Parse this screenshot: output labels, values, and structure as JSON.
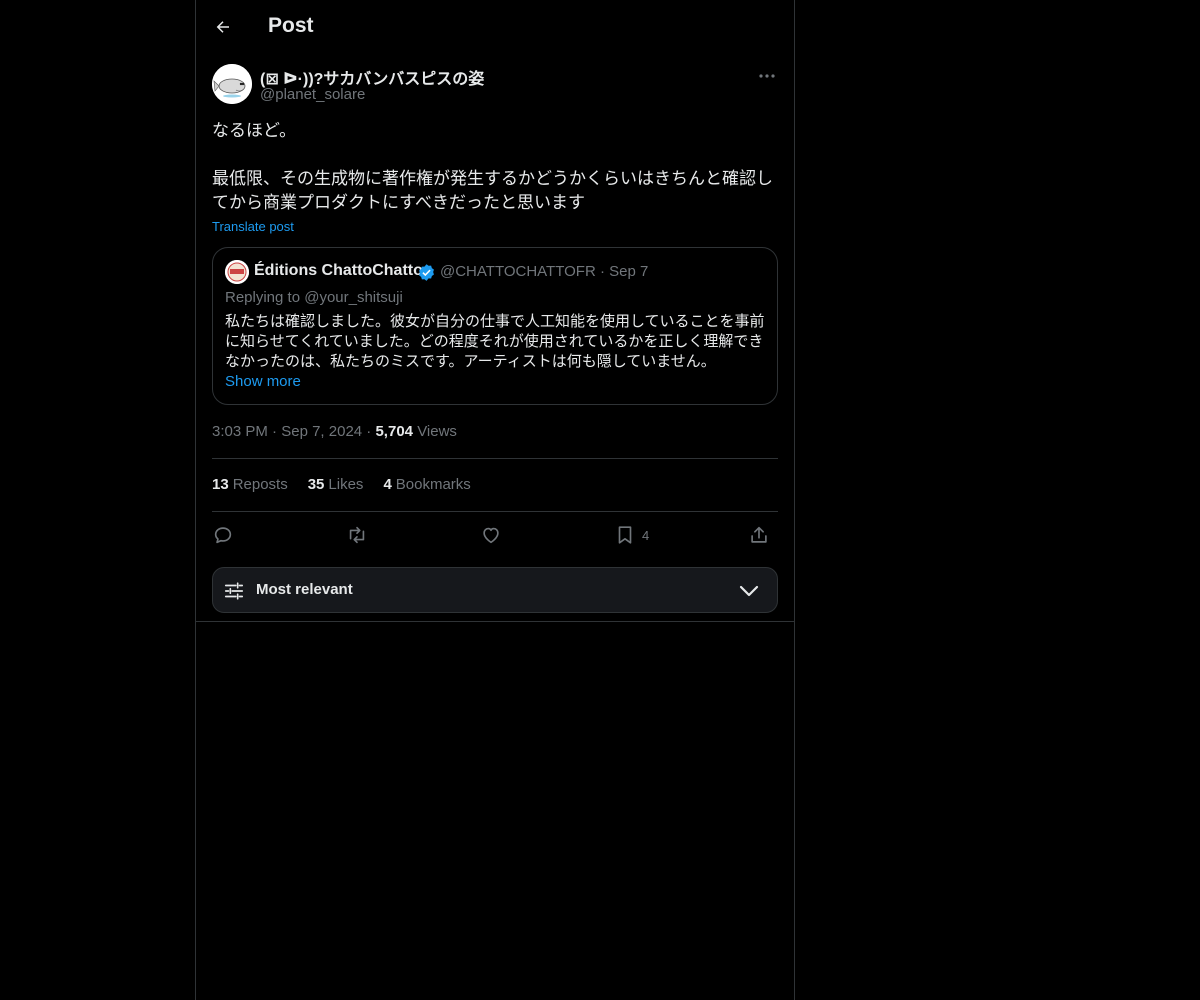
{
  "header": {
    "title": "Post"
  },
  "post": {
    "author_name": "(⊠ ᐅ·))?サカバンバスピスの姿",
    "author_handle": "@planet_solare",
    "text": "なるほど。\n\n最低限、その生成物に著作権が発生するかどうかくらいはきちんと確認してから商業プロダクトにすべきだったと思います",
    "translate_label": "Translate post",
    "time": "3:03 PM",
    "date": "Sep 7, 2024",
    "views_count": "5,704",
    "views_label": "Views"
  },
  "quote": {
    "author_name": "Éditions ChattoChatto",
    "author_handle": "@CHATTOCHATTOFR",
    "date": "Sep 7",
    "replying_to": "Replying to @your_shitsuji",
    "text": "私たちは確認しました。彼女が自分の仕事で人工知能を使用していることを事前に知らせてくれていました。どの程度それが使用されているかを正しく理解できなかったのは、私たちのミスです。アーティストは何も隠していません。",
    "show_more": "Show more"
  },
  "stats": {
    "reposts_count": "13",
    "reposts_label": "Reposts",
    "likes_count": "35",
    "likes_label": "Likes",
    "bookmarks_count": "4",
    "bookmarks_label": "Bookmarks"
  },
  "actions": {
    "bookmark_count": "4",
    "icons": [
      "reply-icon",
      "repost-icon",
      "like-icon",
      "bookmark-icon",
      "share-icon"
    ]
  },
  "sort": {
    "label": "Most relevant"
  },
  "colors": {
    "background": "#000000",
    "text": "#e7e9ea",
    "muted": "#71767b",
    "accent": "#1d9bf0",
    "border": "#2f3336"
  }
}
